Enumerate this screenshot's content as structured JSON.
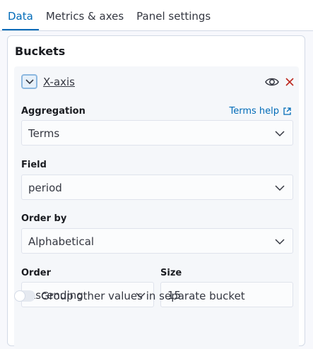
{
  "tabs": [
    {
      "label": "Data",
      "active": true
    },
    {
      "label": "Metrics & axes",
      "active": false
    },
    {
      "label": "Panel settings",
      "active": false
    }
  ],
  "panel": {
    "title": "Buckets",
    "bucket": {
      "name": "X-axis",
      "icons": {
        "toggle": "chevron-down-icon",
        "visibility": "eye-icon",
        "remove": "close-icon"
      },
      "aggregation": {
        "label": "Aggregation",
        "help": "Terms help",
        "value": "Terms"
      },
      "field": {
        "label": "Field",
        "value": "period"
      },
      "order_by": {
        "label": "Order by",
        "value": "Alphabetical"
      },
      "order": {
        "label": "Order",
        "value": "Ascending"
      },
      "size": {
        "label": "Size",
        "value": "15"
      },
      "group_other": {
        "label": "Group other values in separate bucket",
        "enabled": false
      }
    }
  },
  "colors": {
    "accent": "#006bb8",
    "danger": "#bd271e",
    "text": "#343741"
  }
}
